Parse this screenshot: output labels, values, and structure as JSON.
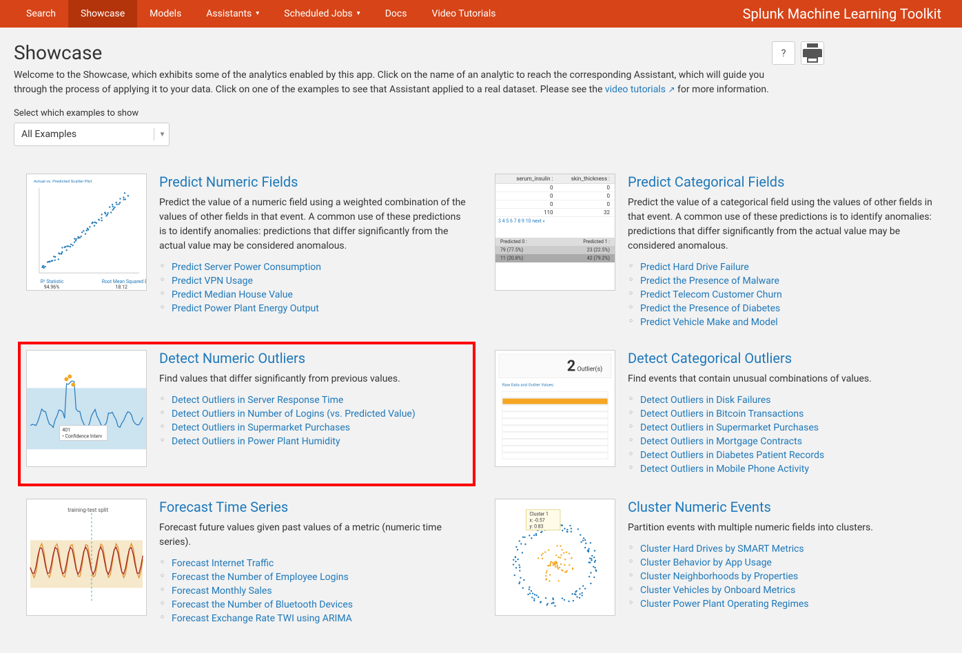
{
  "nav": {
    "items": [
      {
        "label": "Search"
      },
      {
        "label": "Showcase"
      },
      {
        "label": "Models"
      },
      {
        "label": "Assistants"
      },
      {
        "label": "Scheduled Jobs"
      },
      {
        "label": "Docs"
      },
      {
        "label": "Video Tutorials"
      }
    ],
    "app_title": "Splunk Machine Learning Toolkit"
  },
  "header": {
    "title": "Showcase",
    "desc_pre": "Welcome to the Showcase, which exhibits some of the analytics enabled by this app. Click on the name of an analytic to reach the corresponding Assistant, which will guide you through the process of applying it to your data. Click on one of the examples to see that Assistant applied to a real dataset. Please see the ",
    "desc_link": "video tutorials",
    "desc_post": " for more information."
  },
  "actions": {
    "help": "?",
    "print_icon": "print-icon"
  },
  "filter": {
    "label": "Select which examples to show",
    "selected": "All Examples"
  },
  "cards": [
    {
      "title": "Predict Numeric Fields",
      "desc": "Predict the value of a numeric field using a weighted combination of the values of other fields in that event. A common use of these predictions is to identify anomalies: predictions that differ significantly from the actual value may be considered anomalous.",
      "examples": [
        "Predict Server Power Consumption",
        "Predict VPN Usage",
        "Predict Median House Value",
        "Predict Power Plant Energy Output"
      ],
      "thumb": {
        "type": "scatter",
        "footer_l": "94.96%",
        "footer_r": "18.12"
      }
    },
    {
      "title": "Predict Categorical Fields",
      "desc": "Predict the value of a categorical field using the values of other fields in that event. A common use of these predictions is to identify anomalies: predictions that differ significantly from the actual value may be considered anomalous.",
      "examples": [
        "Predict Hard Drive Failure",
        "Predict the Presence of Malware",
        "Predict Telecom Customer Churn",
        "Predict the Presence of Diabetes",
        "Predict Vehicle Make and Model"
      ],
      "thumb": {
        "type": "table",
        "headers": [
          "serum_insulin",
          "skin_thickness"
        ],
        "rows": [
          [
            "0",
            "0"
          ],
          [
            "0",
            "0"
          ],
          [
            "0",
            "0"
          ],
          [
            "110",
            "32"
          ]
        ],
        "pager": "3   4   5   6   7   8   9   10   next »",
        "pred": [
          [
            "Predicted 0",
            ""
          ],
          [
            "79 (77.5%)",
            "23 (22.5%)"
          ],
          [
            "11 (20.8%)",
            "42 (79.2%)"
          ]
        ],
        "pred_hdr_r": "Predicted 1"
      }
    },
    {
      "title": "Detect Numeric Outliers",
      "desc": "Find values that differ significantly from previous values.",
      "examples": [
        "Detect Outliers in Server Response Time",
        "Detect Outliers in Number of Logins (vs. Predicted Value)",
        "Detect Outliers in Supermarket Purchases",
        "Detect Outliers in Power Plant Humidity"
      ],
      "thumb": {
        "type": "outlier",
        "label1": "401",
        "label2": "• Confidence Interv"
      }
    },
    {
      "title": "Detect Categorical Outliers",
      "desc": "Find events that contain unusual combinations of values.",
      "examples": [
        "Detect Outliers in Disk Failures",
        "Detect Outliers in Bitcoin Transactions",
        "Detect Outliers in Supermarket Purchases",
        "Detect Outliers in Mortgage Contracts",
        "Detect Outliers in Diabetes Patient Records",
        "Detect Outliers in Mobile Phone Activity"
      ],
      "thumb": {
        "type": "outlier-count",
        "big": "2",
        "suffix": "Outlier(s)"
      }
    },
    {
      "title": "Forecast Time Series",
      "desc": "Forecast future values given past values of a metric (numeric time series).",
      "examples": [
        "Forecast Internet Traffic",
        "Forecast the Number of Employee Logins",
        "Forecast Monthly Sales",
        "Forecast the Number of Bluetooth Devices",
        "Forecast Exchange Rate TWI using ARIMA"
      ],
      "thumb": {
        "type": "forecast",
        "label": "training-test split"
      }
    },
    {
      "title": "Cluster Numeric Events",
      "desc": "Partition events with multiple numeric fields into clusters.",
      "examples": [
        "Cluster Hard Drives by SMART Metrics",
        "Cluster Behavior by App Usage",
        "Cluster Neighborhoods by Properties",
        "Cluster Vehicles by Onboard Metrics",
        "Cluster Power Plant Operating Regimes"
      ],
      "thumb": {
        "type": "cluster",
        "tip": "Cluster 1",
        "tx": "x: -0.57",
        "ty": "y: 0.83"
      }
    }
  ]
}
